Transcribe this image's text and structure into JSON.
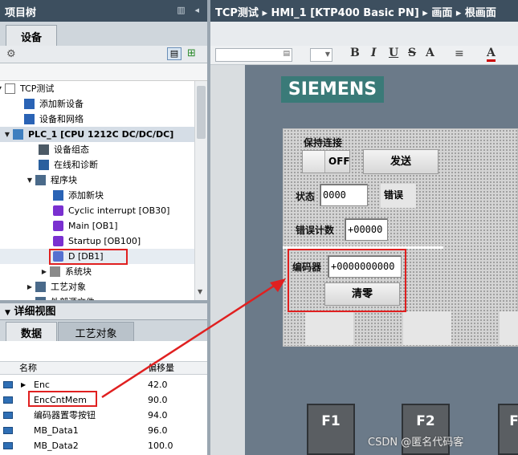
{
  "left_panel": {
    "title": "项目树",
    "tab": "设备",
    "tree": [
      {
        "label": "TCP测试",
        "icon": "project-icon",
        "expand": "▼"
      },
      {
        "label": "添加新设备",
        "icon": "add-device-icon",
        "expand": ""
      },
      {
        "label": "设备和网络",
        "icon": "network-icon",
        "expand": ""
      },
      {
        "label": "PLC_1 [CPU 1212C DC/DC/DC]",
        "icon": "plc-icon",
        "expand": "▼"
      },
      {
        "label": "设备组态",
        "icon": "device-config-icon",
        "expand": ""
      },
      {
        "label": "在线和诊断",
        "icon": "diagnostics-icon",
        "expand": ""
      },
      {
        "label": "程序块",
        "icon": "folder-icon",
        "expand": "▼"
      },
      {
        "label": "添加新块",
        "icon": "add-block-icon",
        "expand": ""
      },
      {
        "label": "Cyclic interrupt [OB30]",
        "icon": "ob-block-icon",
        "expand": ""
      },
      {
        "label": "Main [OB1]",
        "icon": "ob-block-icon",
        "expand": ""
      },
      {
        "label": "Startup [OB100]",
        "icon": "ob-block-icon",
        "expand": ""
      },
      {
        "label": "D [DB1]",
        "icon": "db-block-icon",
        "expand": ""
      },
      {
        "label": "系统块",
        "icon": "system-block-icon",
        "expand": "▶"
      },
      {
        "label": "工艺对象",
        "icon": "folder-icon",
        "expand": "▶"
      },
      {
        "label": "外部源文件",
        "icon": "folder-icon",
        "expand": "▶"
      }
    ]
  },
  "detail_view": {
    "title": "详细视图",
    "tabs": [
      "数据",
      "工艺对象"
    ],
    "columns": [
      "名称",
      "偏移量"
    ],
    "rows": [
      {
        "name": "Enc",
        "offset": "42.0",
        "expand": "▶"
      },
      {
        "name": "EncCntMem",
        "offset": "90.0",
        "expand": ""
      },
      {
        "name": "编码器置零按钮",
        "offset": "94.0",
        "expand": ""
      },
      {
        "name": "MB_Data1",
        "offset": "96.0",
        "expand": ""
      },
      {
        "name": "MB_Data2",
        "offset": "100.0",
        "expand": ""
      }
    ]
  },
  "editor": {
    "breadcrumb": "TCP测试 ▸ HMI_1 [KTP400 Basic PN] ▸ 画面 ▸ 根画面",
    "toolbar": {
      "bold": "B",
      "italic": "I",
      "underline": "U",
      "strike": "S",
      "superscript": "A",
      "font_color": "A"
    }
  },
  "hmi": {
    "brand": "SIEMENS",
    "keep_connection_label": "保持连接",
    "toggle_off": "OFF",
    "send_button": "发送",
    "status_label": "状态",
    "status_value": "0000",
    "error_label": "错误",
    "error_count_label": "错误计数",
    "error_count_value": "+00000",
    "encoder_label": "编码器",
    "encoder_value": "+0000000000",
    "clear_button": "清零",
    "fkeys": [
      "F1",
      "F2",
      "F"
    ]
  },
  "watermark": "CSDN @匿名代码客",
  "colors": {
    "header": "#3d4f5f",
    "highlight": "#e02020",
    "hmi_bg": "#6b7a89",
    "brand": "#3a7a78"
  }
}
